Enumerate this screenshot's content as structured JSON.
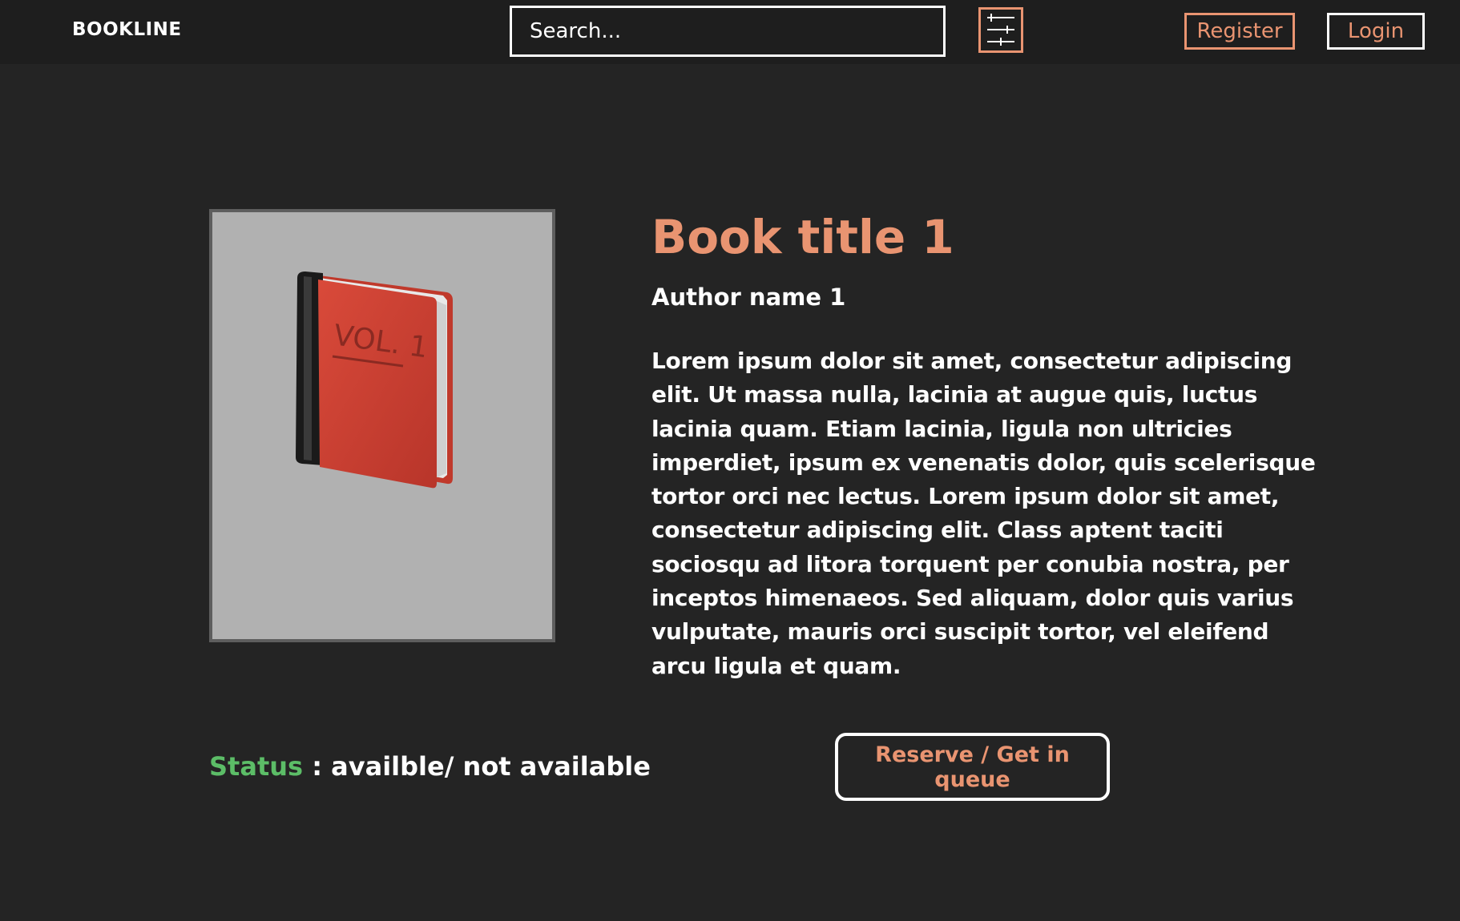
{
  "header": {
    "brand": "BOOKLINE",
    "search_placeholder": "Search...",
    "filter_icon": "sliders-icon",
    "register_label": "Register",
    "login_label": "Login"
  },
  "book": {
    "cover_icon": "red-book-icon",
    "cover_text": "VOL. 1",
    "title": "Book title 1",
    "author": "Author name 1",
    "description": "Lorem ipsum dolor sit amet, consectetur adipiscing elit. Ut massa nulla, lacinia at augue quis, luctus lacinia quam. Etiam lacinia, ligula non ultricies imperdiet, ipsum ex venenatis dolor, quis scelerisque tortor orci nec lectus. Lorem ipsum dolor sit amet, consectetur adipiscing elit. Class aptent taciti sociosqu ad litora torquent per conubia nostra, per inceptos himenaeos. Sed aliquam, dolor quis varius vulputate, mauris orci suscipit tortor, vel eleifend arcu ligula et quam."
  },
  "status": {
    "label": "Status",
    "value": " : availble/ not available"
  },
  "actions": {
    "reserve_label": "Reserve / Get in queue"
  },
  "colors": {
    "background": "#242424",
    "header_background": "#1e1e1e",
    "accent": "#e99471",
    "status_green": "#5cbd67",
    "cover_background": "#b1b1b1"
  }
}
